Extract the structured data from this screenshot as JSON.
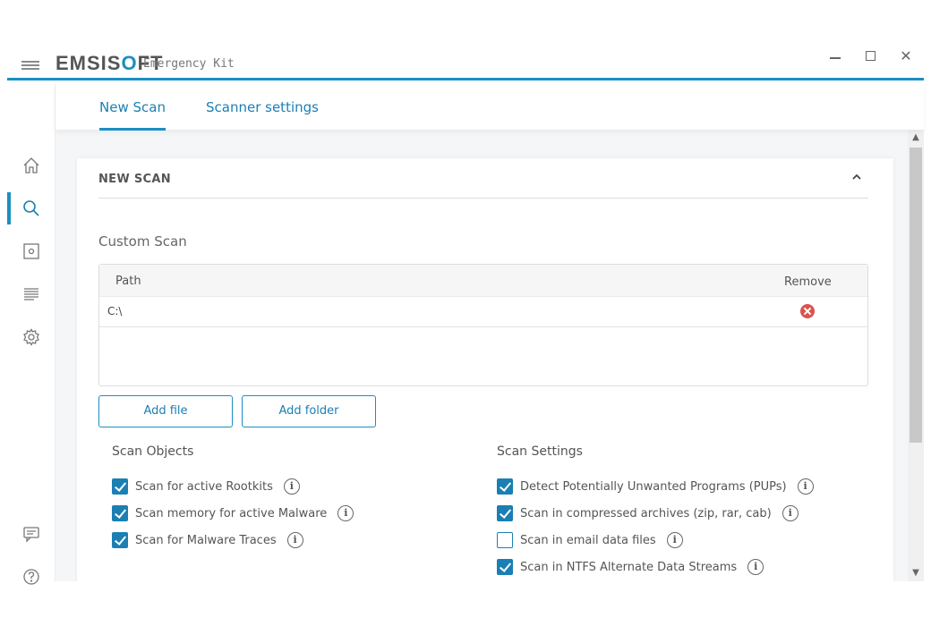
{
  "brand": {
    "name_prefix": "EMSIS",
    "name_o": "O",
    "name_suffix": "FT",
    "subtitle": "Emergency Kit",
    "accent_color": "#1b8ec3"
  },
  "window_controls": {
    "minimize_icon": "minimize-icon",
    "maximize_icon": "maximize-icon",
    "close_symbol": "✕"
  },
  "nav": [
    {
      "name": "home",
      "icon": "home-icon"
    },
    {
      "name": "scan",
      "icon": "search-icon",
      "active": true
    },
    {
      "name": "quarantine",
      "icon": "quarantine-icon"
    },
    {
      "name": "logs",
      "icon": "logs-icon"
    },
    {
      "name": "settings",
      "icon": "gear-icon"
    },
    {
      "name": "feedback",
      "icon": "chat-icon"
    },
    {
      "name": "help",
      "icon": "help-icon"
    }
  ],
  "tabs": [
    {
      "label": "New Scan",
      "active": true
    },
    {
      "label": "Scanner settings",
      "active": false
    }
  ],
  "section": {
    "title": "NEW SCAN",
    "subtitle": "Custom Scan"
  },
  "table": {
    "headers": {
      "path": "Path",
      "remove": "Remove"
    },
    "rows": [
      {
        "path": "C:\\"
      }
    ]
  },
  "buttons": {
    "add_file": "Add file",
    "add_folder": "Add folder"
  },
  "scan_objects": {
    "title": "Scan Objects",
    "options": [
      {
        "label": "Scan for active Rootkits",
        "checked": true
      },
      {
        "label": "Scan memory for active Malware",
        "checked": true
      },
      {
        "label": "Scan for Malware Traces",
        "checked": true
      }
    ]
  },
  "scan_settings": {
    "title": "Scan Settings",
    "options": [
      {
        "label": "Detect Potentially Unwanted Programs (PUPs)",
        "checked": true
      },
      {
        "label": "Scan in compressed archives (zip, rar, cab)",
        "checked": true
      },
      {
        "label": "Scan in email data files",
        "checked": false
      },
      {
        "label": "Scan in NTFS Alternate Data Streams",
        "checked": true
      }
    ]
  },
  "info_glyph": "i",
  "scroll_up": "▲",
  "scroll_down": "▼"
}
